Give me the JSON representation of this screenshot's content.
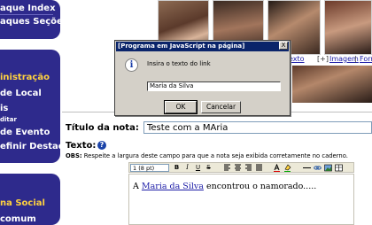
{
  "sidebar": {
    "top_items": [
      "aque Index",
      "aques Seções"
    ],
    "admin_head": "inistração",
    "admin_items": [
      " de Local",
      "is",
      "ditar",
      " de Evento",
      "efinir Destaq."
    ],
    "social_head": "na Social",
    "social_items": [
      " comum"
    ]
  },
  "photos": {
    "link_texto": "exto",
    "link_add": "[+]",
    "link_imagem": "Imagem",
    "link_sep": "|",
    "link_form": "Form"
  },
  "form": {
    "title_label": "Título da nota:",
    "title_value": "Teste com a MAria",
    "text_label": "Texto:",
    "help_icon_label": "?",
    "obs_label": "OBS:",
    "obs_text": " Respeite a largura deste campo para que a nota seja exibida corretamente no caderno."
  },
  "toolbar": {
    "font_size": "1 (8 pt)",
    "bold": "B",
    "italic": "I",
    "underline": "U",
    "strike": "S"
  },
  "editor": {
    "prefix": "A ",
    "link_text": "Maria da Silva",
    "suffix": " encontrou o namorado....."
  },
  "dialog": {
    "title": "[Programa em JavaScript na página]",
    "close_label": "X",
    "message": "Insira o texto do link",
    "input_value": "Maria da Silva",
    "ok_label": "OK",
    "cancel_label": "Cancelar"
  },
  "colors": {
    "sidebar_bg": "#2e2a8c",
    "sidebar_heading": "#ffd23f",
    "titlebar": "#0a246a",
    "link": "#1a1aa6"
  }
}
